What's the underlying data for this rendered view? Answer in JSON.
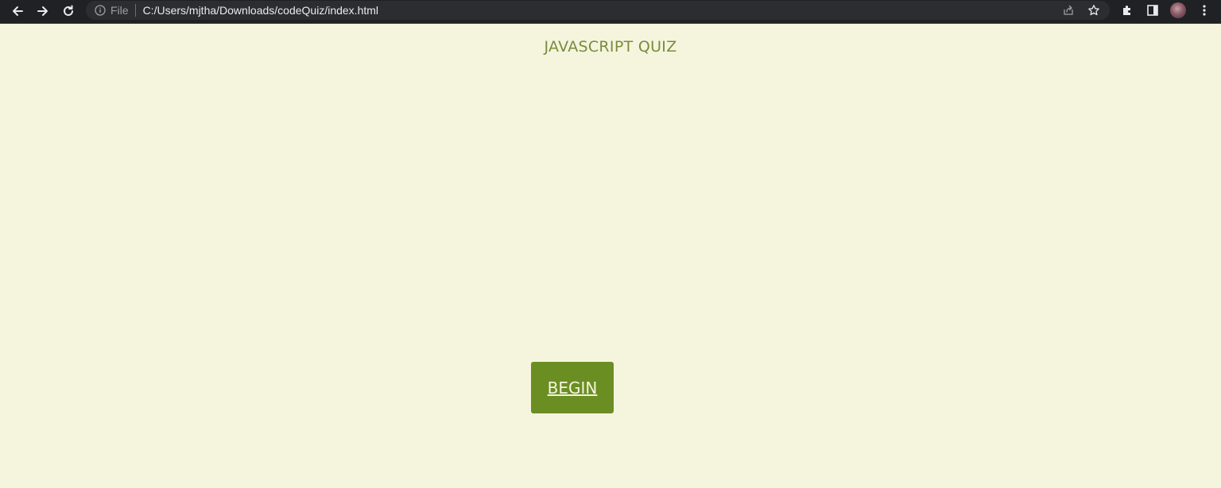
{
  "browser": {
    "scheme_label": "File",
    "url": "C:/Users/mjtha/Downloads/codeQuiz/index.html",
    "icons": {
      "back": "back-arrow-icon",
      "forward": "forward-arrow-icon",
      "reload": "reload-icon",
      "info": "info-icon",
      "share": "share-icon",
      "bookmark": "star-icon",
      "extensions": "puzzle-icon",
      "side_panel": "side-panel-icon",
      "profile": "avatar",
      "menu": "kebab-menu-icon"
    }
  },
  "page": {
    "title": "JAVASCRIPT QUIZ",
    "begin_label": "BEGIN"
  },
  "colors": {
    "background": "#f5f5de",
    "title": "#7a8b3c",
    "button_bg": "#6b8e23",
    "button_text": "#f5f5de",
    "chrome_bg": "#202124"
  }
}
